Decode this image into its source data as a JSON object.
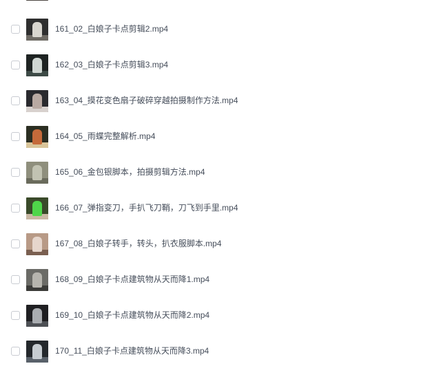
{
  "files": [
    {
      "name": "",
      "thumb_colors": [
        "#8a8278",
        "#c9c1b6",
        "#4a4540"
      ]
    },
    {
      "name": "161_02_白娘子卡点剪辑2.mp4",
      "thumb_colors": [
        "#2f2f2f",
        "#d9d6cf",
        "#6e6a64"
      ]
    },
    {
      "name": "162_03_白娘子卡点剪辑3.mp4",
      "thumb_colors": [
        "#1e2322",
        "#cfd6d2",
        "#3d4a46"
      ]
    },
    {
      "name": "163_04_摸花变色扇子破碎穿越拍摄制作方法.mp4",
      "thumb_colors": [
        "#2a2a2e",
        "#b9a9a2",
        "#d8d1ce"
      ]
    },
    {
      "name": "164_05_雨蝶完整解析.mp4",
      "thumb_colors": [
        "#2b2e22",
        "#c56a3a",
        "#d9c59a"
      ]
    },
    {
      "name": "165_06_金包银脚本，拍摄剪辑方法.mp4",
      "thumb_colors": [
        "#8f8f7d",
        "#c2c3b2",
        "#6a6b5c"
      ]
    },
    {
      "name": "166_07_弹指变刀，手扒飞刀鞘，刀飞到手里.mp4",
      "thumb_colors": [
        "#3a4a2a",
        "#4fd64a",
        "#c9b8a4"
      ]
    },
    {
      "name": "167_08_白娘子转手，转头，扒衣服脚本.mp4",
      "thumb_colors": [
        "#b89a86",
        "#e6d6cc",
        "#7a5f50"
      ]
    },
    {
      "name": "168_09_白娘子卡点建筑物从天而降1.mp4",
      "thumb_colors": [
        "#6b6b66",
        "#b7b5ae",
        "#3b3b38"
      ]
    },
    {
      "name": "169_10_白娘子卡点建筑物从天而降2.mp4",
      "thumb_colors": [
        "#1f1f22",
        "#a9acb0",
        "#4d5055"
      ]
    },
    {
      "name": "170_11_白娘子卡点建筑物从天而降3.mp4",
      "thumb_colors": [
        "#24282c",
        "#c6ccd1",
        "#59616a"
      ]
    }
  ]
}
